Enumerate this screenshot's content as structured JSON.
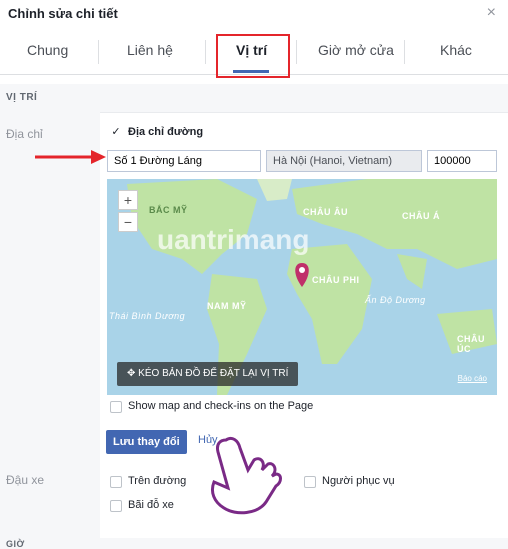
{
  "dialog": {
    "title": "Chỉnh sửa chi tiết",
    "close_glyph": "×"
  },
  "tabs": [
    {
      "label": "Chung"
    },
    {
      "label": "Liên hệ"
    },
    {
      "label": "Vị trí"
    },
    {
      "label": "Giờ mở cửa"
    },
    {
      "label": "Khác"
    }
  ],
  "section": {
    "location_header": "VỊ TRÍ",
    "hours_header": "GIỜ"
  },
  "address": {
    "label": "Địa chỉ",
    "street_checkbox_label": "Địa chỉ đường",
    "street_checked": true,
    "street_value": "Số 1 Đường Láng",
    "city_value": "Hà Nội (Hanoi, Vietnam)",
    "zip_value": "100000"
  },
  "map": {
    "zoom_in": "+",
    "zoom_out": "−",
    "regions": [
      "BẮC MỸ",
      "CHÂU ÂU",
      "CHÂU Á",
      "CHÂU PHI",
      "NAM MỸ",
      "Ấn Độ Dương",
      "Thái Bình Dương",
      "CHÂU ÚC"
    ],
    "watermark": "uantrimang",
    "drag_label": "KÉO BẢN ĐỒ ĐỂ ĐẶT LẠI VỊ TRÍ",
    "report_link": "Báo cáo",
    "water_color": "#a9d3e8",
    "land_color": "#bfe3a4",
    "pin_color": "#c0306a"
  },
  "show_map": {
    "label": "Show map and check-ins on the Page",
    "checked": false
  },
  "actions": {
    "save_label": "Lưu thay đổi",
    "cancel_label": "Hủy"
  },
  "parking": {
    "label": "Đậu xe",
    "options": [
      {
        "label": "Trên đường",
        "checked": false
      },
      {
        "label": "Người phục vụ",
        "checked": false
      },
      {
        "label": "Bãi đỗ xe",
        "checked": false
      }
    ]
  },
  "annotation": {
    "arrow_color": "#e4252b",
    "highlight_color": "#e4252b"
  }
}
